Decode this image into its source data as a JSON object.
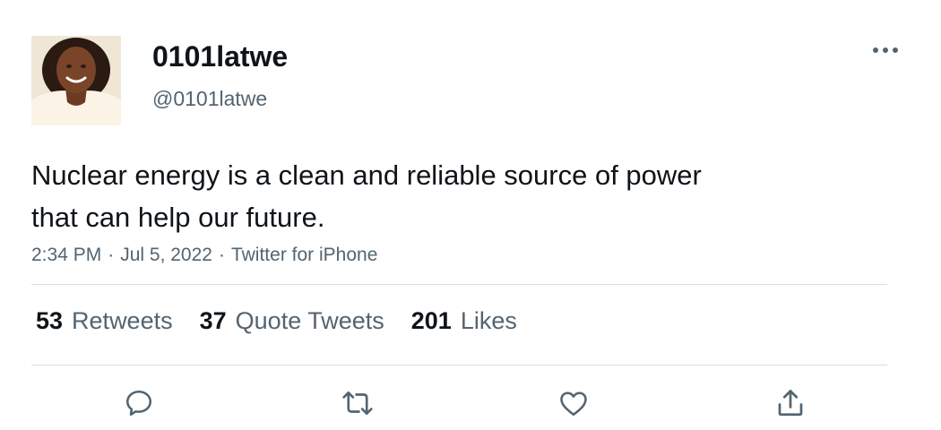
{
  "tweet": {
    "display_name": "0101latwe",
    "handle": "@0101latwe",
    "text_line1": "Nuclear energy is a clean and reliable source of power",
    "text_line2": "that can help our future.",
    "time": "2:34 PM",
    "date": "Jul 5, 2022",
    "source": "Twitter for iPhone",
    "separator": "·"
  },
  "stats": {
    "retweets_count": "53",
    "retweets_label": "Retweets",
    "quote_count": "37",
    "quote_label": "Quote Tweets",
    "likes_count": "201",
    "likes_label": "Likes"
  },
  "actions": [
    {
      "icon": "reply-icon"
    },
    {
      "icon": "retweet-icon"
    },
    {
      "icon": "like-icon"
    },
    {
      "icon": "share-icon"
    }
  ],
  "colors": {
    "text_primary": "#0f1419",
    "text_secondary": "#536471",
    "divider": "#d9dde1",
    "icon": "#536471"
  }
}
